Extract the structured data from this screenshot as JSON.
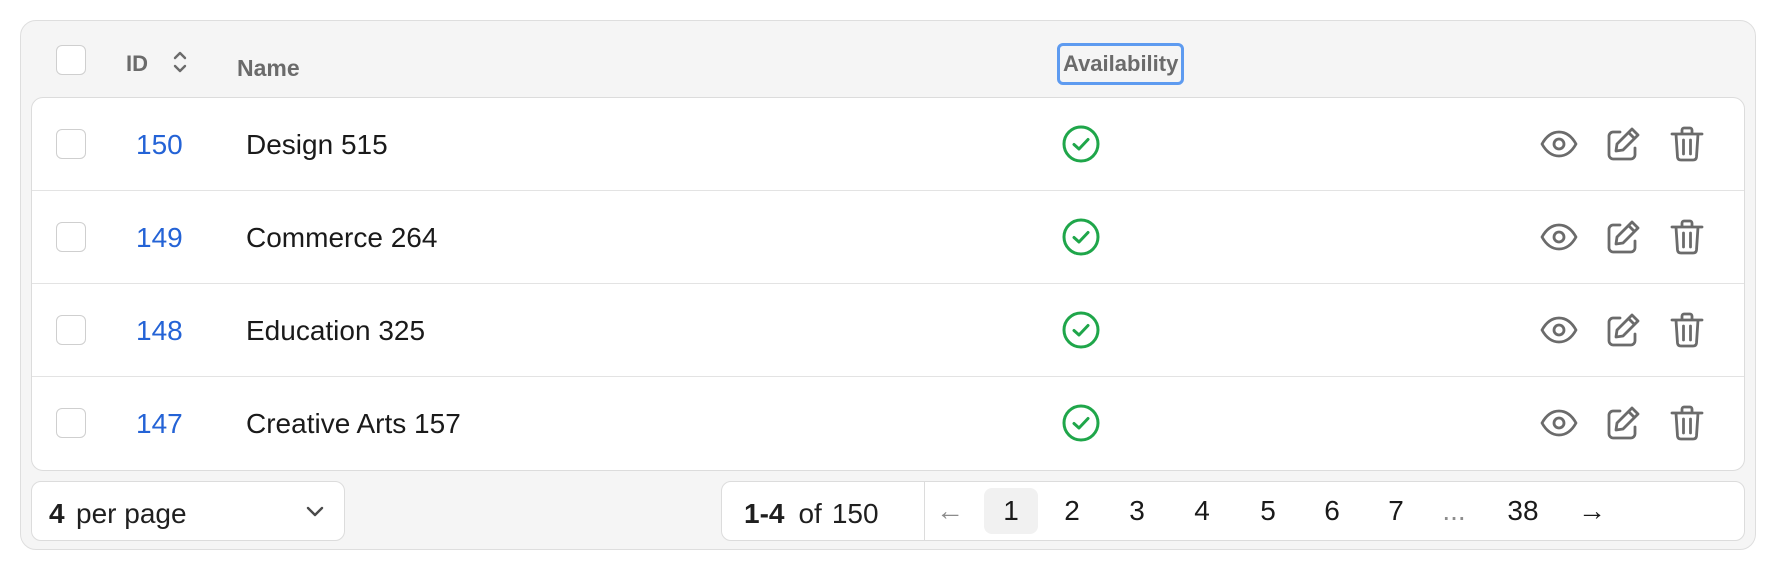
{
  "header": {
    "id_label": "ID",
    "name_label": "Name",
    "availability_label": "Availability"
  },
  "rows": [
    {
      "id": "150",
      "name": "Design 515",
      "available": true
    },
    {
      "id": "149",
      "name": "Commerce 264",
      "available": true
    },
    {
      "id": "148",
      "name": "Education 325",
      "available": true
    },
    {
      "id": "147",
      "name": "Creative Arts 157",
      "available": true
    }
  ],
  "footer": {
    "per_page_value": "4",
    "per_page_label": "per page",
    "range": "1-4",
    "of_label": "of",
    "total": "150",
    "pages": [
      "1",
      "2",
      "3",
      "4",
      "5",
      "6",
      "7"
    ],
    "ellipsis": "...",
    "last_page": "38",
    "prev_arrow": "←",
    "next_arrow": "→",
    "current_page": "1"
  },
  "icons": {
    "sort": "sort-icon",
    "available": "check-circle-icon",
    "view": "eye-icon",
    "edit": "pencil-square-icon",
    "delete": "trash-icon",
    "dropdown": "chevron-down-icon"
  },
  "colors": {
    "link": "#2463d6",
    "available": "#1fa64a",
    "action_icon": "#6b6b6b",
    "focus_ring": "#5e9bf0"
  }
}
